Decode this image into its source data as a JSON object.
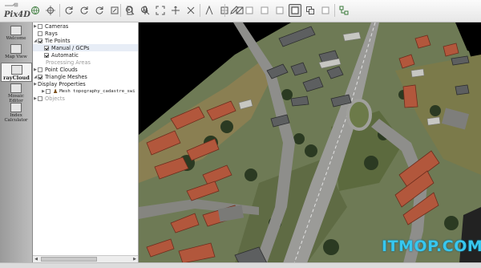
{
  "app": {
    "logo_text": "Pix4D"
  },
  "toolbar": {
    "icons": [
      "globe-icon",
      "crosshair-icon",
      "refresh-icon",
      "refresh-icon",
      "refresh-icon",
      "edit-icon",
      "document-icon",
      "mic-icon",
      "zoom-in-icon",
      "zoom-out-icon",
      "fit-view-icon",
      "move-icon",
      "rotate-icon",
      "measure-icon",
      "grid-icon",
      "split-icon",
      "pencil-icon",
      "square-icon",
      "square-icon",
      "square-icon",
      "square-icon",
      "layers-icon",
      "network-icon"
    ]
  },
  "sidedock": {
    "items": [
      {
        "label": "Welcome"
      },
      {
        "label": "Map View"
      },
      {
        "label": "rayCloud"
      },
      {
        "label": "Mosaic Editor"
      },
      {
        "label": "Index Calculator"
      }
    ],
    "active": "rayCloud"
  },
  "layers": {
    "cameras": "Cameras",
    "rays": "Rays",
    "tie_points": "Tie Points",
    "manual_gcps": "Manual / GCPs",
    "automatic": "Automatic",
    "processing_areas": "Processing Areas",
    "point_clouds": "Point Clouds",
    "triangle_meshes": "Triangle Meshes",
    "display_properties": "Display Properties",
    "mesh_name": "Mesh topography_cadastre_swi",
    "objects": "Objects"
  },
  "watermark": "ITMOP.COM",
  "colors": {
    "accent": "#37c7ef",
    "panel_bg": "#ffffff",
    "dock_bg": "#a8a8a8"
  }
}
